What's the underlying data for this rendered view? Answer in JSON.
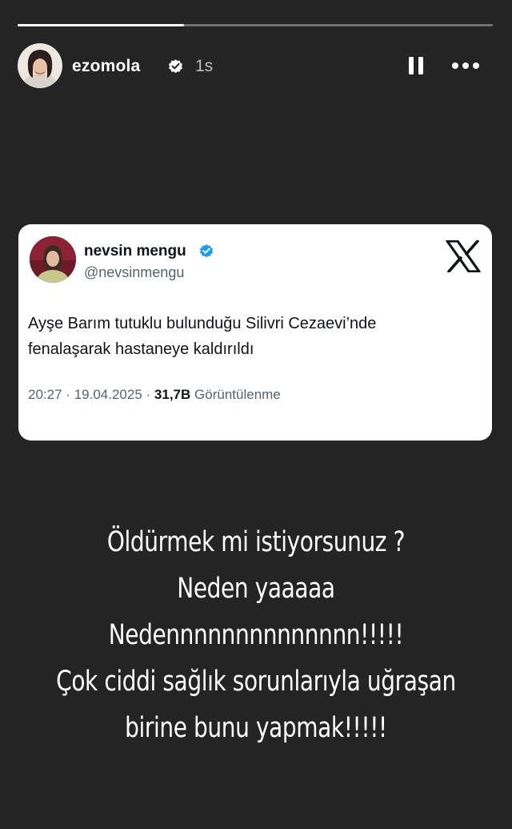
{
  "story": {
    "progress": 0.35,
    "background": "#242424"
  },
  "header": {
    "username": "ezomola",
    "verified_icon": "verified-badge-icon",
    "time": "1s",
    "pause_icon": "pause-icon",
    "more_icon": "more-options-icon"
  },
  "tweet": {
    "display_name": "nevsin mengu",
    "handle": "@nevsinmengu",
    "verified_icon": "verified-badge-icon",
    "platform_icon": "x-logo-icon",
    "text_line1": "Ayşe Barım tutuklu bulunduğu Silivri Cezaevi’nde",
    "text_line2": "fenalaşarak hastaneye kaldırıldı",
    "time": "20:27",
    "date": "19.04.2025",
    "views_count": "31,7B",
    "views_label": "Görüntülenme",
    "separator": "·"
  },
  "caption": {
    "lines": [
      "Öldürmek mi istiyorsunuz ?",
      "Neden yaaaaa",
      "Nedennnnnnnnnnnnnn!!!!!",
      "Çok ciddi sağlık sorunlarıyla uğraşan",
      "birine bunu yapmak!!!!!"
    ]
  },
  "colors": {
    "accent_verified": "#1d9bf0",
    "text_primary": "#0f1419",
    "text_secondary": "#536471"
  }
}
